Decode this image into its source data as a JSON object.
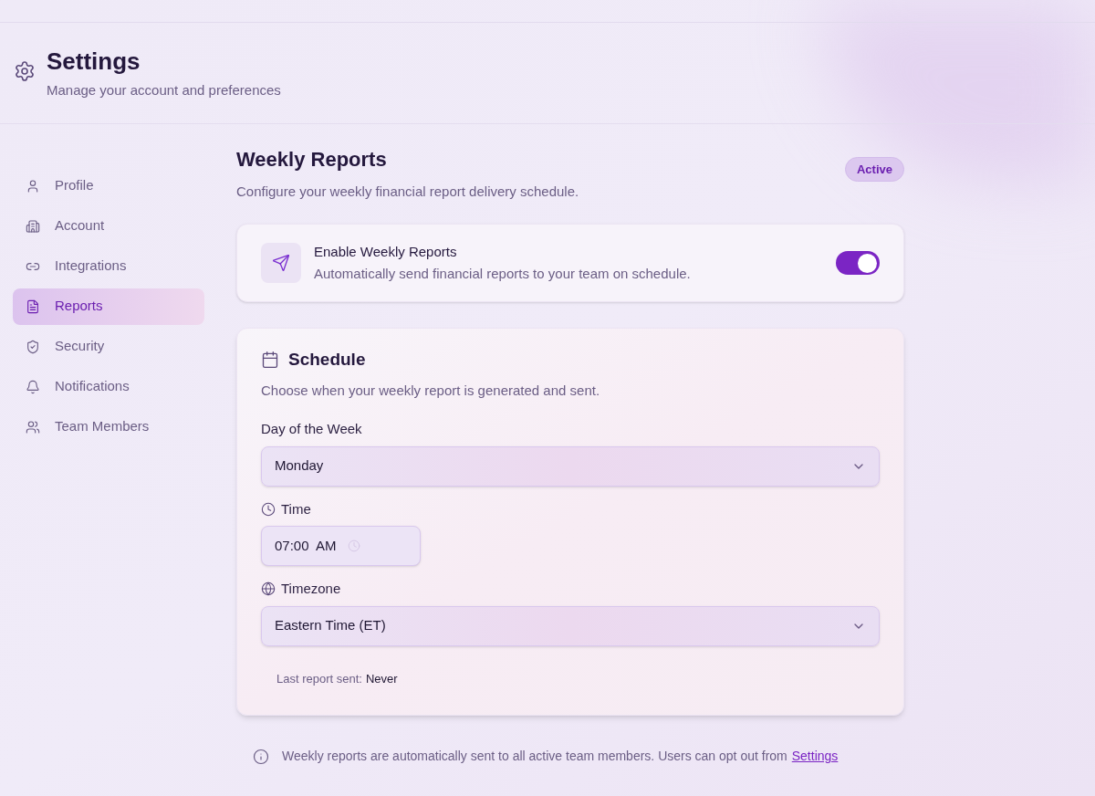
{
  "header": {
    "title": "Settings",
    "subtitle": "Manage your account and preferences"
  },
  "sidebar": {
    "items": [
      {
        "label": "Profile",
        "kind": "user",
        "selected": false
      },
      {
        "label": "Account",
        "kind": "building",
        "selected": false
      },
      {
        "label": "Integrations",
        "kind": "link",
        "selected": false
      },
      {
        "label": "Reports",
        "kind": "file",
        "selected": true
      },
      {
        "label": "Security",
        "kind": "shield",
        "selected": false
      },
      {
        "label": "Notifications",
        "kind": "bell",
        "selected": false
      },
      {
        "label": "Team Members",
        "kind": "users",
        "selected": false
      }
    ]
  },
  "page": {
    "title": "Weekly Reports",
    "subtitle": "Configure your weekly financial report delivery schedule.",
    "badge": "Active"
  },
  "enable_card": {
    "title": "Enable Weekly Reports",
    "description": "Automatically send financial reports to your team on schedule.",
    "on": true
  },
  "schedule": {
    "title": "Schedule",
    "description": "Choose when your weekly report is generated and sent.",
    "fields": [
      {
        "kind": "day",
        "label": "Day of the Week",
        "value": "Monday"
      },
      {
        "kind": "time",
        "label": "Time",
        "value": "07:00  AM"
      },
      {
        "kind": "zone",
        "label": "Timezone",
        "value": "Eastern Time (ET)"
      }
    ],
    "last_sent_label": "Last report sent:",
    "last_sent_value": "Never"
  },
  "note": {
    "text": "Weekly reports are automatically sent to all active team members. Users can opt out from",
    "link": "Settings"
  }
}
